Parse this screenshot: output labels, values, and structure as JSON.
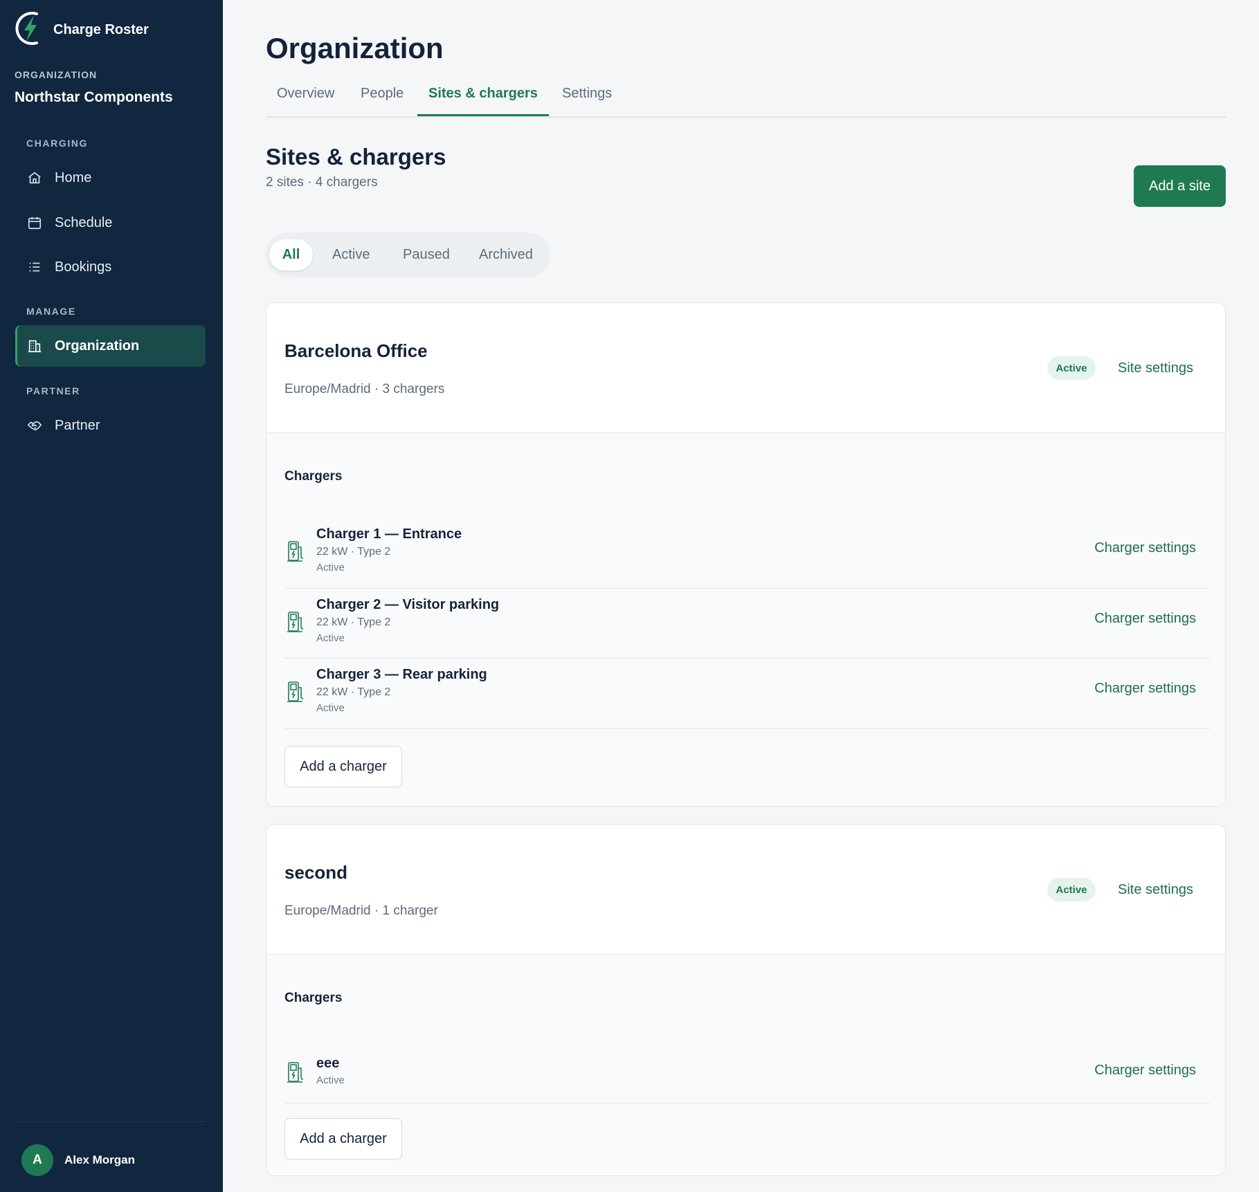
{
  "app": {
    "name": "Charge Roster"
  },
  "sidebar": {
    "org_label": "ORGANIZATION",
    "org_name": "Northstar Components",
    "sections": {
      "charging": "CHARGING",
      "manage": "MANAGE",
      "partner": "PARTNER"
    },
    "items": {
      "home": "Home",
      "schedule": "Schedule",
      "bookings": "Bookings",
      "organization": "Organization",
      "partner": "Partner"
    },
    "user": {
      "initial": "A",
      "name": "Alex Morgan"
    }
  },
  "page": {
    "title": "Organization",
    "tabs": [
      "Overview",
      "People",
      "Sites & chargers",
      "Settings"
    ],
    "active_tab": "Sites & chargers"
  },
  "sites_section": {
    "title": "Sites & chargers",
    "summary": "2 sites · 4 chargers",
    "add_site_label": "Add a site",
    "filters": [
      "All",
      "Active",
      "Paused",
      "Archived"
    ],
    "active_filter": "All"
  },
  "sites": [
    {
      "name": "Barcelona Office",
      "meta": "Europe/Madrid · 3 chargers",
      "status": "Active",
      "settings_label": "Site settings",
      "chargers_label": "Chargers",
      "add_charger_label": "Add a charger",
      "chargers": [
        {
          "name": "Charger 1 — Entrance",
          "spec": "22 kW · Type 2",
          "status": "Active",
          "settings_label": "Charger settings"
        },
        {
          "name": "Charger 2 — Visitor parking",
          "spec": "22 kW · Type 2",
          "status": "Active",
          "settings_label": "Charger settings"
        },
        {
          "name": "Charger 3 — Rear parking",
          "spec": "22 kW · Type 2",
          "status": "Active",
          "settings_label": "Charger settings"
        }
      ]
    },
    {
      "name": "second",
      "meta": "Europe/Madrid · 1 charger",
      "status": "Active",
      "settings_label": "Site settings",
      "chargers_label": "Chargers",
      "add_charger_label": "Add a charger",
      "chargers": [
        {
          "name": "eee",
          "status": "Active",
          "settings_label": "Charger settings"
        }
      ]
    }
  ],
  "colors": {
    "sidebar_bg": "#11263f",
    "accent": "#1f7a52",
    "active_nav_bg": "#1a4a4a",
    "badge_bg": "#e4f3ec"
  },
  "icons": {
    "brand": "lightning-bolt-icon",
    "home": "home-icon",
    "schedule": "calendar-icon",
    "bookings": "list-icon",
    "organization": "building-icon",
    "partner": "handshake-icon",
    "charger": "ev-charger-icon"
  }
}
